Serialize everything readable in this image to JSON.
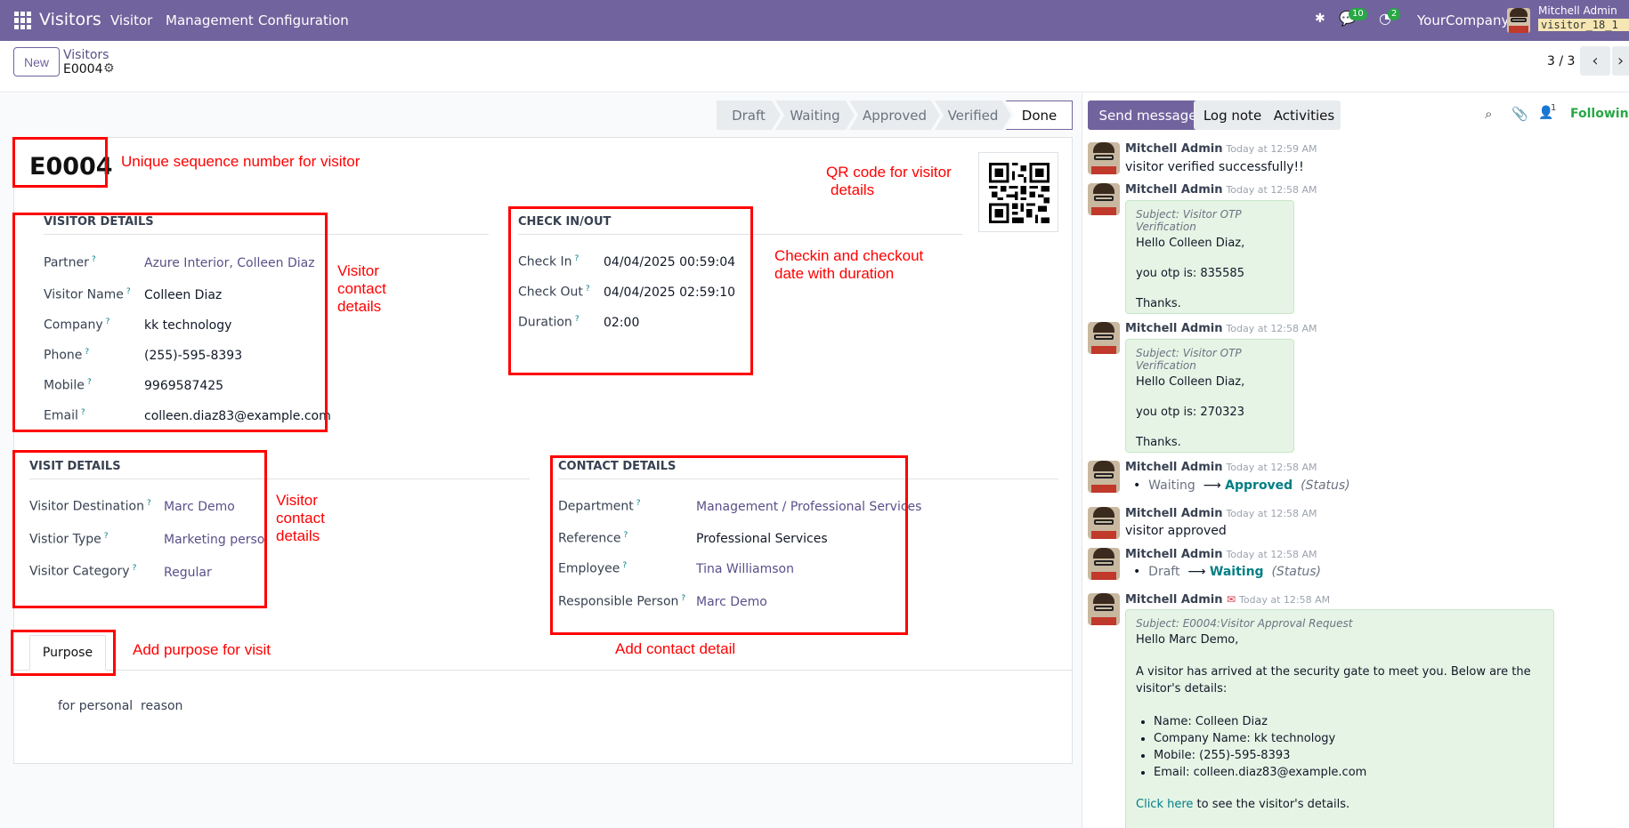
{
  "topbar": {
    "app_name": "Visitors",
    "menus": [
      "Visitor",
      "Management",
      "Configuration"
    ],
    "chat_badge": "10",
    "activity_badge": "2",
    "company": "YourCompany",
    "user_name": "Mitchell Admin",
    "db_name": "visitor_18_1",
    "bg_color": "#71639e"
  },
  "control_panel": {
    "new_label": "New",
    "breadcrumb": "Visitors",
    "record_name": "E0004",
    "pager": "3 / 3"
  },
  "statusbar": [
    "Draft",
    "Waiting",
    "Approved",
    "Verified",
    "Done"
  ],
  "statusbar_active": "Done",
  "form": {
    "title": "E0004",
    "visitor_details": {
      "heading": "VISITOR DETAILS",
      "fields": [
        {
          "label": "Partner",
          "value": "Azure Interior, Colleen Diaz"
        },
        {
          "label": "Visitor Name",
          "value": "Colleen Diaz"
        },
        {
          "label": "Company",
          "value": "kk technology"
        },
        {
          "label": "Phone",
          "value": "(255)-595-8393"
        },
        {
          "label": "Mobile",
          "value": "9969587425"
        },
        {
          "label": "Email",
          "value": "colleen.diaz83@example.com"
        }
      ]
    },
    "check_inout": {
      "heading": "CHECK IN/OUT",
      "fields": [
        {
          "label": "Check In",
          "value": "04/04/2025 00:59:04"
        },
        {
          "label": "Check Out",
          "value": "04/04/2025 02:59:10"
        },
        {
          "label": "Duration",
          "value": "02:00"
        }
      ]
    },
    "visit_details": {
      "heading": "VISIT DETAILS",
      "fields": [
        {
          "label": "Visitor Destination",
          "value": "Marc Demo"
        },
        {
          "label": "Vistior Type",
          "value": "Marketing person"
        },
        {
          "label": "Visitor Category",
          "value": "Regular"
        }
      ]
    },
    "contact_details": {
      "heading": "CONTACT DETAILS",
      "fields": [
        {
          "label": "Department",
          "value": "Management / Professional Services"
        },
        {
          "label": "Reference",
          "value": "Professional Services"
        },
        {
          "label": "Employee",
          "value": "Tina Williamson"
        },
        {
          "label": "Responsible Person",
          "value": "Marc Demo"
        }
      ]
    },
    "tab_label": "Purpose",
    "purpose_text": "for personal  reason"
  },
  "annotations": {
    "sequence": "Unique sequence number for visitor",
    "qr": [
      "QR code for visitor",
      "details"
    ],
    "visitor_contact": [
      "Visitor",
      "contact",
      "details"
    ],
    "checkin": [
      "Checkin and checkout",
      "date with duration"
    ],
    "visit_contact": [
      "Visitor",
      "contact",
      "details"
    ],
    "purpose": "Add purpose for visit",
    "contact": "Add contact detail"
  },
  "chatter": {
    "send_message": "Send message",
    "log_note": "Log note",
    "activities": "Activities",
    "follower_count": "1",
    "following": "Following",
    "messages": [
      {
        "author": "Mitchell Admin",
        "time": "Today at 12:59 AM",
        "body": "visitor verified successfully!!"
      },
      {
        "author": "Mitchell Admin",
        "time": "Today at 12:58 AM",
        "subject": "Subject: Visitor OTP Verification",
        "lines": [
          "Hello Colleen Diaz,",
          "you otp is: 835585",
          "Thanks."
        ]
      },
      {
        "author": "Mitchell Admin",
        "time": "Today at 12:58 AM",
        "subject": "Subject: Visitor OTP Verification",
        "lines": [
          "Hello Colleen Diaz,",
          "you otp is: 270323",
          "Thanks."
        ]
      },
      {
        "author": "Mitchell Admin",
        "time": "Today at 12:58 AM",
        "from": "Waiting",
        "to": "Approved",
        "field": "(Status)"
      },
      {
        "author": "Mitchell Admin",
        "time": "Today at 12:58 AM",
        "body": "visitor approved"
      },
      {
        "author": "Mitchell Admin",
        "time": "Today at 12:58 AM",
        "from": "Draft",
        "to": "Waiting",
        "field": "(Status)"
      },
      {
        "author": "Mitchell Admin",
        "time": "Today at 12:58 AM",
        "subject": "Subject: E0004:Visitor Approval Request",
        "greeting": "Hello Marc Demo,",
        "intro": "A visitor has arrived at the security gate to meet you. Below are the visitor's details:",
        "items": [
          "Name: Colleen Diaz",
          "Company Name: kk technology",
          "Mobile: (255)-595-8393",
          "Email: colleen.diaz83@example.com"
        ],
        "link_text": "Click here",
        "link_rest": " to see the visitor's details."
      }
    ]
  }
}
